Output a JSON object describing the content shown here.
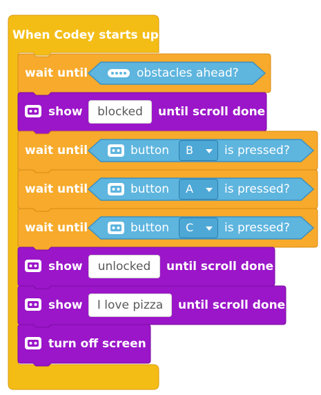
{
  "script": {
    "hat_label": "When Codey starts up",
    "blocks": [
      {
        "type": "wait_until",
        "label": "wait until",
        "condition": {
          "icon": "ultrasonic-sensor-icon",
          "label": "obstacles ahead?"
        }
      },
      {
        "type": "show",
        "label": "show",
        "icon": "codey-icon",
        "text_value": "blocked",
        "suffix": "until scroll done"
      },
      {
        "type": "wait_until",
        "label": "wait until",
        "condition": {
          "icon": "codey-icon",
          "label": "button",
          "dropdown": "B",
          "suffix": "is pressed?"
        }
      },
      {
        "type": "wait_until",
        "label": "wait until",
        "condition": {
          "icon": "codey-icon",
          "label": "button",
          "dropdown": "A",
          "suffix": "is pressed?"
        }
      },
      {
        "type": "wait_until",
        "label": "wait until",
        "condition": {
          "icon": "codey-icon",
          "label": "button",
          "dropdown": "C",
          "suffix": "is pressed?"
        }
      },
      {
        "type": "show",
        "label": "show",
        "icon": "codey-icon",
        "text_value": "unlocked",
        "suffix": "until scroll done"
      },
      {
        "type": "show",
        "label": "show",
        "icon": "codey-icon",
        "text_value": "I love pizza",
        "suffix": "until scroll done"
      },
      {
        "type": "turn_off",
        "label": "turn off screen",
        "icon": "codey-icon"
      }
    ]
  },
  "colors": {
    "hat": "#f4bd16",
    "control": "#f7aa2b",
    "display": "#9b15c9",
    "sensing": "#5eb5de"
  }
}
